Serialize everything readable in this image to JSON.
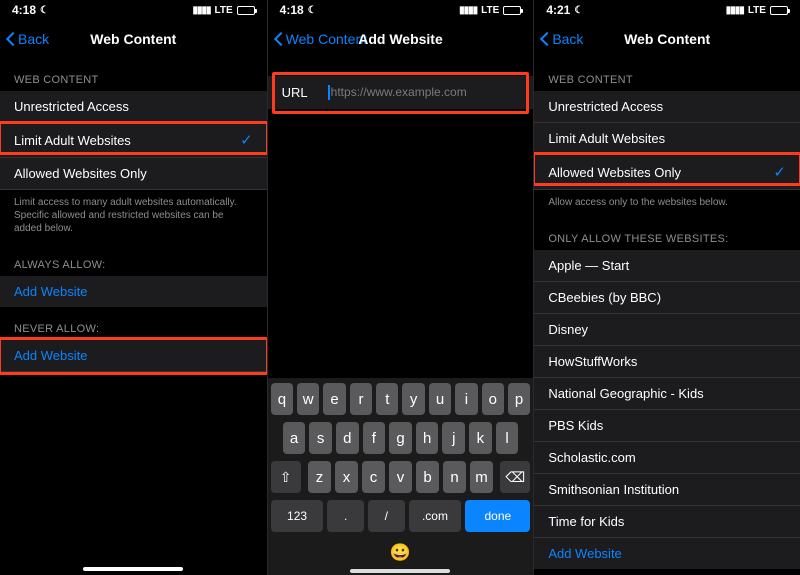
{
  "colors": {
    "accent": "#0a84ff",
    "highlight": "#ff3b1f"
  },
  "panel1": {
    "status": {
      "time": "4:18",
      "net": "LTE"
    },
    "nav": {
      "back": "Back",
      "title": "Web Content"
    },
    "header1": "WEB CONTENT",
    "options": {
      "unrestricted": "Unrestricted Access",
      "limit_adult": "Limit Adult Websites",
      "allowed_only": "Allowed Websites Only"
    },
    "footer1": "Limit access to many adult websites automatically. Specific allowed and restricted websites can be added below.",
    "header_always": "ALWAYS ALLOW:",
    "header_never": "NEVER ALLOW:",
    "add_website": "Add Website"
  },
  "panel2": {
    "status": {
      "time": "4:18",
      "net": "LTE"
    },
    "nav": {
      "back": "Web Content",
      "title": "Add Website"
    },
    "url_label": "URL",
    "url_placeholder": "https://www.example.com",
    "keys": {
      "r1": [
        "q",
        "w",
        "e",
        "r",
        "t",
        "y",
        "u",
        "i",
        "o",
        "p"
      ],
      "r2": [
        "a",
        "s",
        "d",
        "f",
        "g",
        "h",
        "j",
        "k",
        "l"
      ],
      "r3": [
        "z",
        "x",
        "c",
        "v",
        "b",
        "n",
        "m"
      ],
      "r4": {
        "n123": "123",
        "dot": ".",
        "slash": "/",
        "com": ".com",
        "done": "done"
      }
    }
  },
  "panel3": {
    "status": {
      "time": "4:21",
      "net": "LTE"
    },
    "nav": {
      "back": "Back",
      "title": "Web Content"
    },
    "header1": "WEB CONTENT",
    "options": {
      "unrestricted": "Unrestricted Access",
      "limit_adult": "Limit Adult Websites",
      "allowed_only": "Allowed Websites Only"
    },
    "footer1": "Allow access only to the websites below.",
    "header_only": "ONLY ALLOW THESE WEBSITES:",
    "sites": [
      "Apple — Start",
      "CBeebies (by BBC)",
      "Disney",
      "HowStuffWorks",
      "National Geographic - Kids",
      "PBS Kids",
      "Scholastic.com",
      "Smithsonian Institution",
      "Time for Kids"
    ],
    "add_website": "Add Website"
  }
}
